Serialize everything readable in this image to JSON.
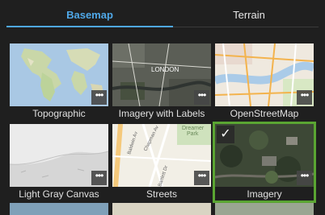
{
  "tabs": [
    {
      "label": "Basemap",
      "active": true
    },
    {
      "label": "Terrain",
      "active": false
    }
  ],
  "colors": {
    "accent": "#4fa8e8",
    "selected_border": "#5aa532",
    "background": "#1f1f1f"
  },
  "more_glyph": "•••",
  "check_glyph": "✓",
  "basemaps": [
    {
      "label": "Topographic",
      "selected": false
    },
    {
      "label": "Imagery with Labels",
      "selected": false,
      "map_text": "LONDON"
    },
    {
      "label": "OpenStreetMap",
      "selected": false
    },
    {
      "label": "Light Gray Canvas",
      "selected": false
    },
    {
      "label": "Streets",
      "selected": false,
      "map_text": [
        "Dreamer",
        "Park",
        "Baldwin Av",
        "Chapman Av",
        "Bartlett Dr"
      ]
    },
    {
      "label": "Imagery",
      "selected": true
    }
  ]
}
